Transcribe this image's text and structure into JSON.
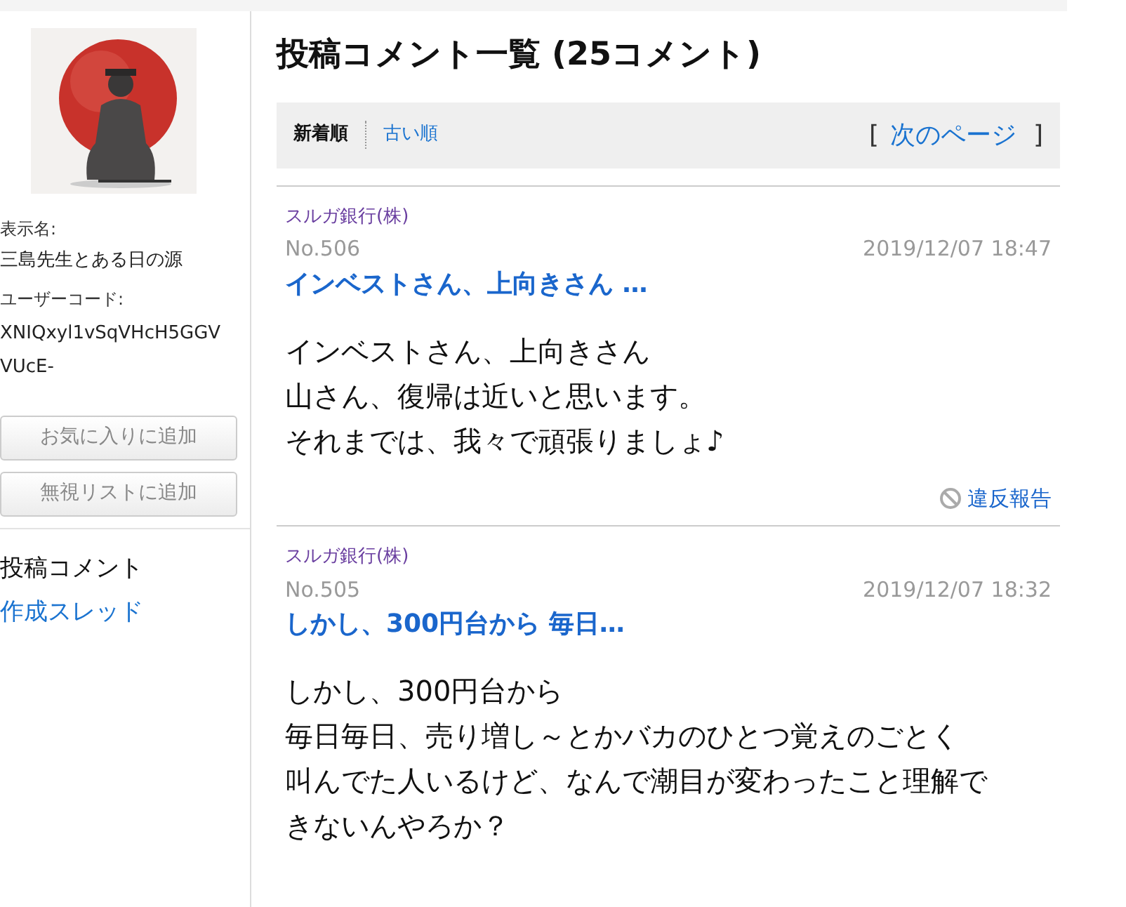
{
  "profile": {
    "display_name_label": "表示名:",
    "display_name": "三島先生とある日の源",
    "user_code_label": "ユーザーコード:",
    "user_code": "XNIQxyl1vSqVHcH5GGVVUcE-",
    "buttons": [
      "お気に入りに追加",
      "無視リストに追加"
    ]
  },
  "sidebar_links": [
    {
      "label": "投稿コメント",
      "selected": true
    },
    {
      "label": "作成スレッド",
      "selected": false
    }
  ],
  "page_title": "投稿コメント一覧 (25コメント)",
  "sort_tabs": [
    {
      "label": "新着順",
      "selected": true
    },
    {
      "label": "古い順",
      "selected": false
    }
  ],
  "pager": {
    "open_bracket": "[",
    "next": "次のページ",
    "close_bracket": "]"
  },
  "comments": [
    {
      "board": "スルガ銀行(株)",
      "number": "No.506",
      "date": "2019/12/07 18:47",
      "title": "インベストさん、上向きさん …",
      "body": [
        "インベストさん、上向きさん",
        "山さん、復帰は近いと思います。",
        "それまでは、我々で頑張りましょ♪"
      ],
      "report": "違反報告"
    },
    {
      "board": "スルガ銀行(株)",
      "number": "No.505",
      "date": "2019/12/07 18:32",
      "title": "しかし、300円台から 毎日…",
      "body": [
        "しかし、300円台から",
        "毎日毎日、売り増し～とかバカのひとつ覚えのごとく",
        "叫んでた人いるけど、なんで潮目が変わったこと理解で",
        "きないんやろか？"
      ]
    }
  ]
}
